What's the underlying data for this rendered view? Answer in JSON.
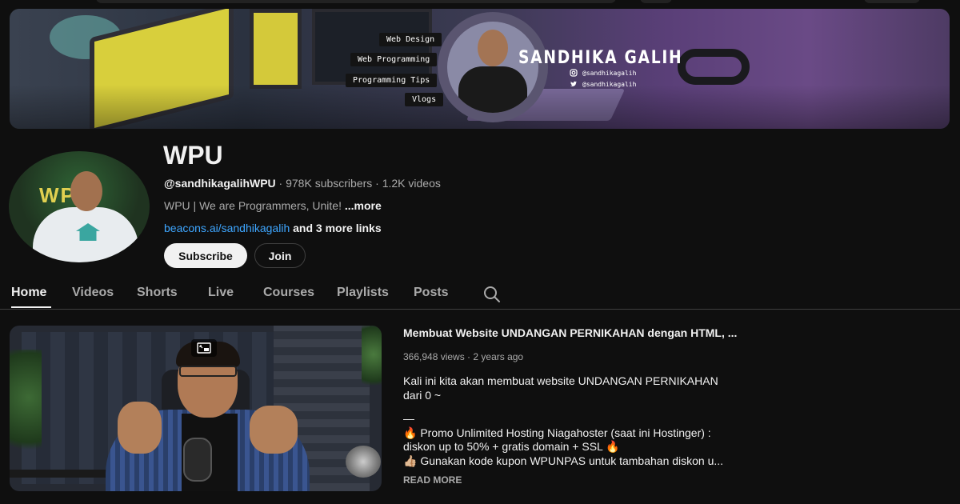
{
  "banner": {
    "tags": [
      "Web Design",
      "Web Programming",
      "Programming Tips",
      "Vlogs"
    ],
    "name": "SANDHIKA GALIH",
    "instagram": "@sandhikagalih",
    "twitter": "@sandhikagalih"
  },
  "avatar": {
    "sign": "WPU"
  },
  "channel": {
    "title": "WPU",
    "handle": "@sandhikagalihWPU",
    "meta_rest": " · 978K subscribers · 1.2K videos",
    "description": "WPU | We are Programmers, Unite! ",
    "description_more": "...more",
    "link": "beacons.ai/sandhikagalih",
    "link_extra": " and 3 more links"
  },
  "buttons": {
    "subscribe": "Subscribe",
    "join": "Join"
  },
  "tabs": [
    "Home",
    "Videos",
    "Shorts",
    "Live",
    "Courses",
    "Playlists",
    "Posts"
  ],
  "featured": {
    "title": "Membuat Website UNDANGAN PERNIKAHAN dengan HTML, ...",
    "meta": "366,948 views · 2 years ago",
    "desc_line1": "Kali ini kita akan membuat website UNDANGAN PERNIKAHAN",
    "desc_line2": "dari 0 ~",
    "desc_dash": "—",
    "desc_line3": "🔥 Promo Unlimited Hosting Niagahoster (saat ini Hostinger) :",
    "desc_line4": "diskon up to 50% + gratis domain + SSL 🔥",
    "desc_line5": "👍🏼 Gunakan kode kupon WPUNPAS untuk tambahan diskon u...",
    "read_more": "READ MORE"
  }
}
